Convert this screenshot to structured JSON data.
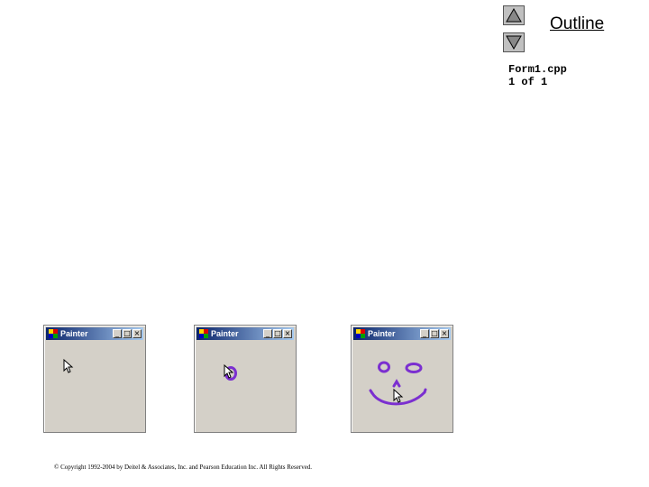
{
  "navigation": {
    "up_icon": "triangle-up-icon",
    "down_icon": "triangle-down-icon",
    "outline_label": "Outline"
  },
  "file_info": {
    "filename": "Form1.cpp",
    "page": "1 of 1"
  },
  "windows": [
    {
      "title": "Painter",
      "state": "cursor only"
    },
    {
      "title": "Painter",
      "state": "one circle drawn"
    },
    {
      "title": "Painter",
      "state": "face drawn"
    }
  ],
  "window_controls": {
    "minimize": "_",
    "maximize": "□",
    "close": "×"
  },
  "colors": {
    "drawing": "#7b2fd0",
    "titlebar_start": "#0a246a",
    "titlebar_end": "#a6caf0",
    "window_face": "#d4d0c8"
  },
  "footer": {
    "copyright": "© Copyright 1992-2004 by Deitel & Associates, Inc. and Pearson Education Inc. All Rights Reserved."
  }
}
